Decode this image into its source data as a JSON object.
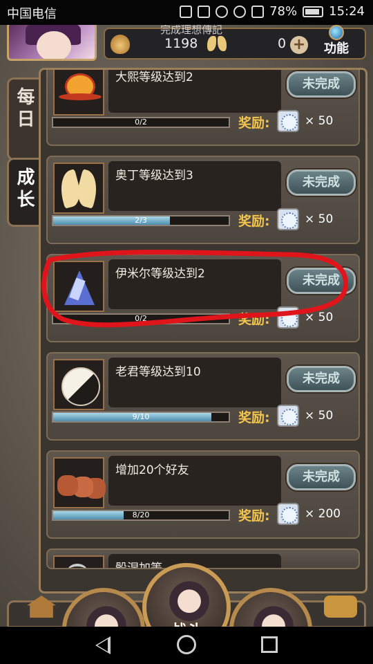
{
  "status_bar": {
    "carrier": "中国电信",
    "battery": "78%",
    "time": "15:24",
    "icons": [
      "nfc-icon",
      "vibrate-icon",
      "alarm-icon",
      "wifi-icon",
      "signal-icon",
      "battery-icon"
    ]
  },
  "header": {
    "partial_title": "完成理想傳記",
    "currency_1": "1198",
    "currency_2": "0",
    "func_label": "功能"
  },
  "tabs": {
    "daily": "每日",
    "growth": "成长"
  },
  "reward_label": "奖励:",
  "quests": [
    {
      "desc": "大熙等级达到2",
      "status": "未完成",
      "progress_text": "0/2",
      "progress": 0.0,
      "reward": "× 50",
      "icon": "sun-icon"
    },
    {
      "desc": "奥丁等级达到3",
      "status": "未完成",
      "progress_text": "2/3",
      "progress": 0.6667,
      "reward": "× 50",
      "icon": "wings-icon"
    },
    {
      "desc": "伊米尔等级达到2",
      "status": "未完成",
      "progress_text": "0/2",
      "progress": 0.0,
      "reward": "× 50",
      "icon": "crystal-icon"
    },
    {
      "desc": "老君等级达到10",
      "status": "未完成",
      "progress_text": "9/10",
      "progress": 0.9,
      "reward": "× 50",
      "icon": "taiji-icon"
    },
    {
      "desc": "增加20个好友",
      "status": "未完成",
      "progress_text": "8/20",
      "progress": 0.4,
      "reward": "× 200",
      "icon": "bears-icon"
    }
  ],
  "partial_quest": {
    "desc": "骰涅加等"
  },
  "bottom": {
    "battle_label": "战斗"
  },
  "colors": {
    "reward_text": "#f4c54d",
    "annotation": "#e0141b",
    "progress_fill": "#4d8eae"
  }
}
